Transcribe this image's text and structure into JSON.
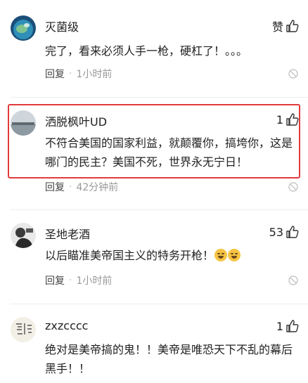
{
  "comments": [
    {
      "username": "灭菌级",
      "likes_text": "赞",
      "content": "完了，看来必须人手一枪，硬杠了！。。。",
      "reply_label": "回复",
      "time": "1小时前"
    },
    {
      "username": "洒脱枫叶UD",
      "likes_text": "1",
      "content": "不符合美国的国家利益，就颠覆你，搞垮你，这是哪门的民主？美国不死，世界永无宁日！",
      "reply_label": "回复",
      "time": "42分钟前"
    },
    {
      "username": "圣地老酒",
      "likes_text": "53",
      "content": "以后瞄准美帝国主义的特务开枪！",
      "reply_label": "回复",
      "time": "1小时前"
    },
    {
      "username": "zxzcccc",
      "likes_text": "1",
      "content": "绝对是美帝搞的鬼！！美帝是唯恐天下不乱的幕后黑手！！"
    }
  ],
  "separator": "·",
  "icons": {
    "like": "thumbs-up-icon",
    "report": "report-icon",
    "emoji": "laughing-emoji-icon"
  },
  "colors": {
    "highlight_border": "#e23a3a",
    "meta_text": "#999999"
  }
}
